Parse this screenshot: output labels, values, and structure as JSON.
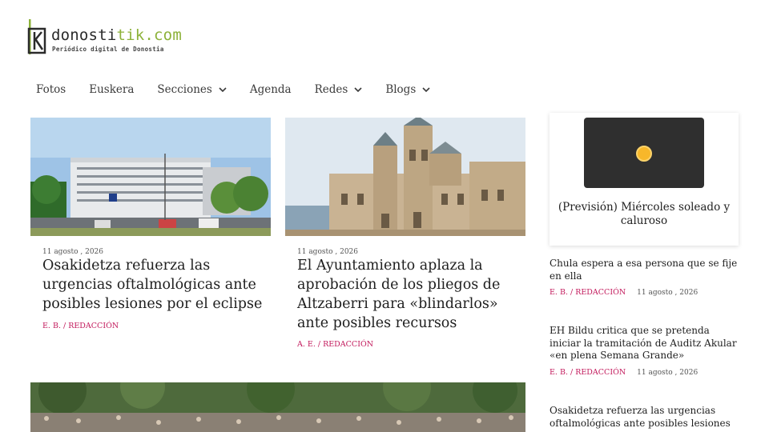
{
  "site": {
    "name_prefix": "donosti",
    "name_accent": "tik",
    "name_suffix": ".com",
    "tagline": "Periódico digital de Donostia"
  },
  "nav": {
    "items": [
      {
        "label": "Fotos",
        "dropdown": false
      },
      {
        "label": "Euskera",
        "dropdown": false
      },
      {
        "label": "Secciones",
        "dropdown": true
      },
      {
        "label": "Agenda",
        "dropdown": false
      },
      {
        "label": "Redes",
        "dropdown": true
      },
      {
        "label": "Blogs",
        "dropdown": true
      }
    ]
  },
  "articles": [
    {
      "date": "11 agosto , 2026",
      "title": "Osakidetza refuerza las urgencias oftalmológicas ante posibles lesiones por el eclipse",
      "author": "E. B. / REDACCIÓN",
      "image": "hospital-building"
    },
    {
      "date": "11 agosto , 2026",
      "title": "El Ayuntamiento aplaza la aprobación de los pliegos de Altzaberri para «blindarlos» ante posibles recursos",
      "author": "A. E. / REDACCIÓN",
      "image": "city-hall"
    },
    {
      "image": "crowd-park"
    }
  ],
  "sidebar": {
    "weather": {
      "title": "(Previsión) Miércoles soleado y caluroso",
      "icon": "sun-icon"
    },
    "items": [
      {
        "title": "Chula espera a esa persona que se fije en ella",
        "author": "E. B. / REDACCIÓN",
        "date": "11 agosto , 2026"
      },
      {
        "title": "EH Bildu critica que se pretenda iniciar la tramitación de Auditz Akular «en plena Semana Grande»",
        "author": "E. B. / REDACCIÓN",
        "date": "11 agosto , 2026"
      },
      {
        "title": "Osakidetza refuerza las urgencias oftalmológicas ante posibles lesiones por",
        "author": "",
        "date": ""
      }
    ]
  },
  "colors": {
    "accent_green": "#8db23a",
    "author_pink": "#c2185b"
  }
}
